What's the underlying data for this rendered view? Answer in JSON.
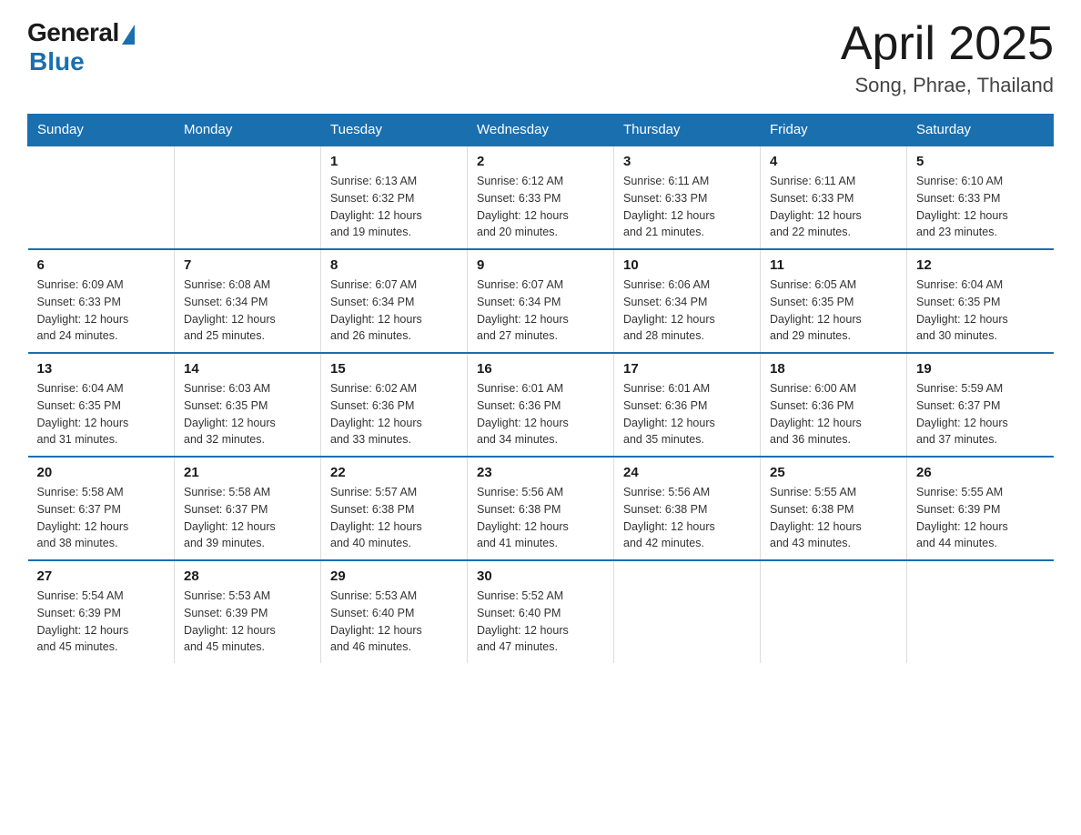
{
  "logo": {
    "general": "General",
    "blue": "Blue"
  },
  "title": "April 2025",
  "location": "Song, Phrae, Thailand",
  "days_of_week": [
    "Sunday",
    "Monday",
    "Tuesday",
    "Wednesday",
    "Thursday",
    "Friday",
    "Saturday"
  ],
  "weeks": [
    [
      {
        "day": "",
        "info": ""
      },
      {
        "day": "",
        "info": ""
      },
      {
        "day": "1",
        "info": "Sunrise: 6:13 AM\nSunset: 6:32 PM\nDaylight: 12 hours\nand 19 minutes."
      },
      {
        "day": "2",
        "info": "Sunrise: 6:12 AM\nSunset: 6:33 PM\nDaylight: 12 hours\nand 20 minutes."
      },
      {
        "day": "3",
        "info": "Sunrise: 6:11 AM\nSunset: 6:33 PM\nDaylight: 12 hours\nand 21 minutes."
      },
      {
        "day": "4",
        "info": "Sunrise: 6:11 AM\nSunset: 6:33 PM\nDaylight: 12 hours\nand 22 minutes."
      },
      {
        "day": "5",
        "info": "Sunrise: 6:10 AM\nSunset: 6:33 PM\nDaylight: 12 hours\nand 23 minutes."
      }
    ],
    [
      {
        "day": "6",
        "info": "Sunrise: 6:09 AM\nSunset: 6:33 PM\nDaylight: 12 hours\nand 24 minutes."
      },
      {
        "day": "7",
        "info": "Sunrise: 6:08 AM\nSunset: 6:34 PM\nDaylight: 12 hours\nand 25 minutes."
      },
      {
        "day": "8",
        "info": "Sunrise: 6:07 AM\nSunset: 6:34 PM\nDaylight: 12 hours\nand 26 minutes."
      },
      {
        "day": "9",
        "info": "Sunrise: 6:07 AM\nSunset: 6:34 PM\nDaylight: 12 hours\nand 27 minutes."
      },
      {
        "day": "10",
        "info": "Sunrise: 6:06 AM\nSunset: 6:34 PM\nDaylight: 12 hours\nand 28 minutes."
      },
      {
        "day": "11",
        "info": "Sunrise: 6:05 AM\nSunset: 6:35 PM\nDaylight: 12 hours\nand 29 minutes."
      },
      {
        "day": "12",
        "info": "Sunrise: 6:04 AM\nSunset: 6:35 PM\nDaylight: 12 hours\nand 30 minutes."
      }
    ],
    [
      {
        "day": "13",
        "info": "Sunrise: 6:04 AM\nSunset: 6:35 PM\nDaylight: 12 hours\nand 31 minutes."
      },
      {
        "day": "14",
        "info": "Sunrise: 6:03 AM\nSunset: 6:35 PM\nDaylight: 12 hours\nand 32 minutes."
      },
      {
        "day": "15",
        "info": "Sunrise: 6:02 AM\nSunset: 6:36 PM\nDaylight: 12 hours\nand 33 minutes."
      },
      {
        "day": "16",
        "info": "Sunrise: 6:01 AM\nSunset: 6:36 PM\nDaylight: 12 hours\nand 34 minutes."
      },
      {
        "day": "17",
        "info": "Sunrise: 6:01 AM\nSunset: 6:36 PM\nDaylight: 12 hours\nand 35 minutes."
      },
      {
        "day": "18",
        "info": "Sunrise: 6:00 AM\nSunset: 6:36 PM\nDaylight: 12 hours\nand 36 minutes."
      },
      {
        "day": "19",
        "info": "Sunrise: 5:59 AM\nSunset: 6:37 PM\nDaylight: 12 hours\nand 37 minutes."
      }
    ],
    [
      {
        "day": "20",
        "info": "Sunrise: 5:58 AM\nSunset: 6:37 PM\nDaylight: 12 hours\nand 38 minutes."
      },
      {
        "day": "21",
        "info": "Sunrise: 5:58 AM\nSunset: 6:37 PM\nDaylight: 12 hours\nand 39 minutes."
      },
      {
        "day": "22",
        "info": "Sunrise: 5:57 AM\nSunset: 6:38 PM\nDaylight: 12 hours\nand 40 minutes."
      },
      {
        "day": "23",
        "info": "Sunrise: 5:56 AM\nSunset: 6:38 PM\nDaylight: 12 hours\nand 41 minutes."
      },
      {
        "day": "24",
        "info": "Sunrise: 5:56 AM\nSunset: 6:38 PM\nDaylight: 12 hours\nand 42 minutes."
      },
      {
        "day": "25",
        "info": "Sunrise: 5:55 AM\nSunset: 6:38 PM\nDaylight: 12 hours\nand 43 minutes."
      },
      {
        "day": "26",
        "info": "Sunrise: 5:55 AM\nSunset: 6:39 PM\nDaylight: 12 hours\nand 44 minutes."
      }
    ],
    [
      {
        "day": "27",
        "info": "Sunrise: 5:54 AM\nSunset: 6:39 PM\nDaylight: 12 hours\nand 45 minutes."
      },
      {
        "day": "28",
        "info": "Sunrise: 5:53 AM\nSunset: 6:39 PM\nDaylight: 12 hours\nand 45 minutes."
      },
      {
        "day": "29",
        "info": "Sunrise: 5:53 AM\nSunset: 6:40 PM\nDaylight: 12 hours\nand 46 minutes."
      },
      {
        "day": "30",
        "info": "Sunrise: 5:52 AM\nSunset: 6:40 PM\nDaylight: 12 hours\nand 47 minutes."
      },
      {
        "day": "",
        "info": ""
      },
      {
        "day": "",
        "info": ""
      },
      {
        "day": "",
        "info": ""
      }
    ]
  ]
}
